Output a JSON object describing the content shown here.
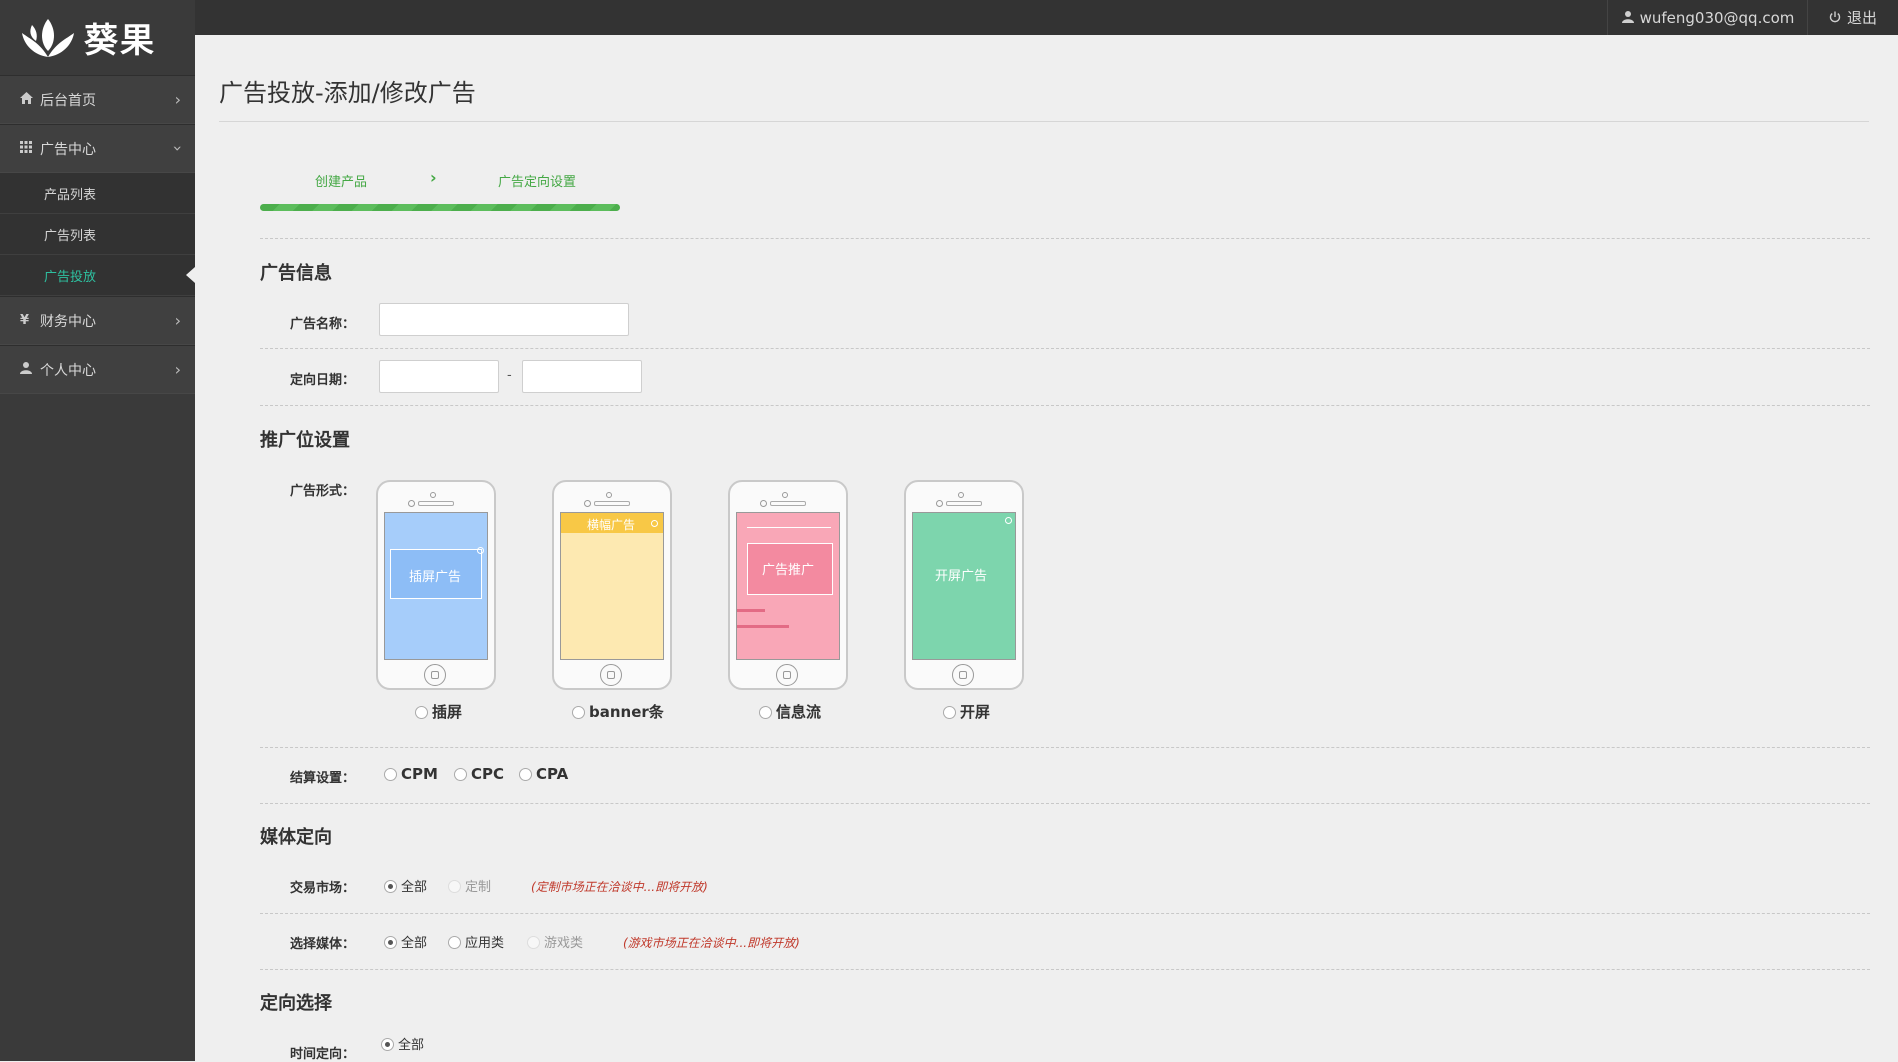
{
  "brand": {
    "name": "葵果"
  },
  "topbar": {
    "user_email": "wufeng030@qq.com",
    "logout_label": "退出"
  },
  "sidebar": {
    "items": [
      {
        "label": "后台首页",
        "icon": "home-icon"
      },
      {
        "label": "广告中心",
        "icon": "grid-icon"
      },
      {
        "label": "财务中心",
        "icon": "yen-icon"
      },
      {
        "label": "个人中心",
        "icon": "user-icon"
      }
    ],
    "sub_items": [
      {
        "label": "产品列表"
      },
      {
        "label": "广告列表"
      },
      {
        "label": "广告投放",
        "active": true
      }
    ]
  },
  "page": {
    "title": "广告投放-添加/修改广告"
  },
  "steps": {
    "step1": "创建产品",
    "step2": "广告定向设置"
  },
  "ad_info": {
    "title": "广告信息",
    "name_label": "广告名称：",
    "date_label": "定向日期：",
    "date_sep": "-"
  },
  "placement": {
    "title": "推广位设置",
    "format_label": "广告形式：",
    "formats": [
      {
        "label": "插屏",
        "screen_text": "插屏广告",
        "color": "#a6cdfa"
      },
      {
        "label": "banner条",
        "screen_text": "横幅广告",
        "color": "#fde9b1"
      },
      {
        "label": "信息流",
        "screen_text": "广告推广",
        "color": "#f9a7b7"
      },
      {
        "label": "开屏",
        "screen_text": "开屏广告",
        "color": "#7dd5ad"
      }
    ]
  },
  "billing": {
    "label": "结算设置：",
    "options": [
      "CPM",
      "CPC",
      "CPA"
    ]
  },
  "media": {
    "title": "媒体定向",
    "market_label": "交易市场：",
    "market_options": [
      "全部",
      "定制"
    ],
    "market_note": "(定制市场正在洽谈中...即将开放)",
    "select_label": "选择媒体：",
    "select_options": [
      "全部",
      "应用类",
      "游戏类"
    ],
    "select_note": "(游戏市场正在洽谈中...即将开放)"
  },
  "targeting": {
    "title": "定向选择",
    "time_label": "时间定向：",
    "time_option": "全部"
  },
  "colors": {
    "accent": "#2ec0a0",
    "step_green": "#44a844",
    "note_red": "#c0392b"
  }
}
